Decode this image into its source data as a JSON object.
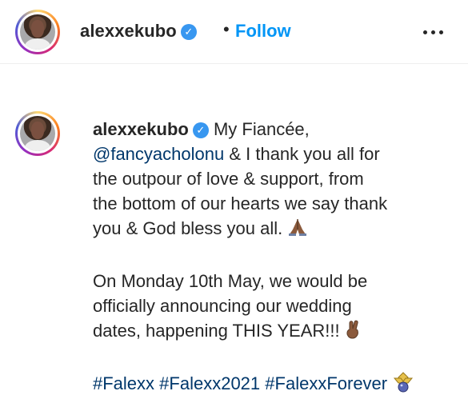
{
  "header": {
    "username": "alexxekubo",
    "separator": "•",
    "follow_label": "Follow"
  },
  "post": {
    "username": "alexxekubo",
    "caption": {
      "line1_text": " My Fiancée,",
      "mention": "@fancyacholonu",
      "line2_text": " & I thank you all for",
      "line3": "the outpour of love & support, from",
      "line4": "the bottom of our hearts we say thank",
      "line5": "you & God bless you all.",
      "line7": "On Monday 10th May, we would be",
      "line8": "officially announcing our wedding",
      "line9": "dates, happening THIS YEAR!!!",
      "hashtags": [
        "#Falexx",
        "#Falexx2021",
        "#FalexxForever"
      ]
    }
  },
  "icons": {
    "verified": "verified-badge-icon",
    "more": "more-options-icon",
    "pray": "folded-hands-emoji",
    "crossed": "crossed-fingers-emoji",
    "ring": "ring-emoji"
  },
  "colors": {
    "link_blue": "#0095f6",
    "hashtag_blue": "#00376b",
    "verified_blue": "#3897f0",
    "text": "#262626"
  }
}
